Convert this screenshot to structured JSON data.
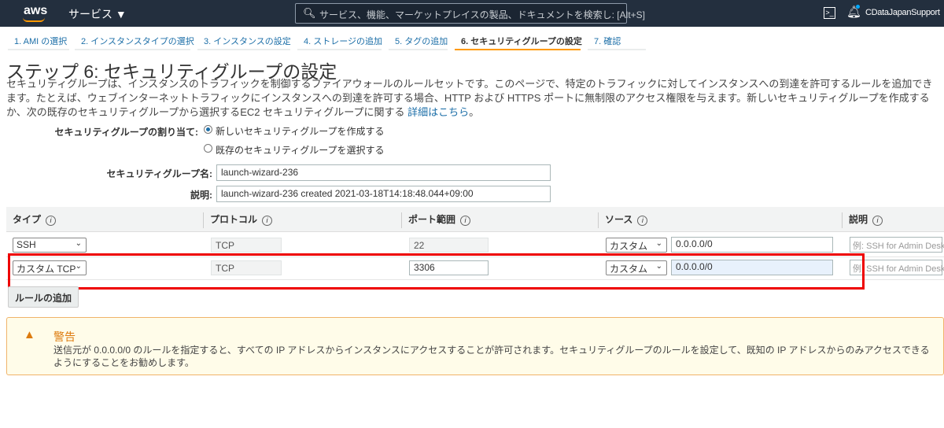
{
  "topbar": {
    "logo": "aws",
    "services": "サービス ▼",
    "search_placeholder": "サービス、機能、マーケットプレイスの製品、ドキュメントを検索し: [Alt+S]",
    "user": "CDataJapanSupport"
  },
  "steps": [
    "1. AMI の選択",
    "2. インスタンスタイプの選択",
    "3. インスタンスの設定",
    "4. ストレージの追加",
    "5. タグの追加",
    "6. セキュリティグループの設定",
    "7. 確認"
  ],
  "active_step": 6,
  "page": {
    "title": "ステップ 6: セキュリティグループの設定",
    "desc1": "セキュリティグループは、インスタンスのトラフィックを制御するファイアウォールのルールセットです。このページで、特定のトラフィックに対してインスタンスへの到達を許可するルールを追加できます。たとえば、ウェブ",
    "desc2": "インターネットトラフィックにインスタンスへの到達を許可する場合、HTTP および HTTPS ポートに無制限のアクセス権限を与えます。新しいセキュリティグループを作成するか、次の既存のセキュリティグループから選択する",
    "desc3": "EC2 セキュリティグループに関する ",
    "link": "詳細はこちら",
    "desc3_end": "。"
  },
  "form": {
    "assign_label": "セキュリティグループの割り当て:",
    "radio_new": "新しいセキュリティグループを作成する",
    "radio_existing": "既存のセキュリティグループを選択する",
    "selected": "new",
    "name_label": "セキュリティグループ名:",
    "name_value": "launch-wizard-236",
    "desc_label": "説明:",
    "desc_value": "launch-wizard-236 created 2021-03-18T14:18:48.044+09:00"
  },
  "table": {
    "headers": [
      "タイプ",
      "プロトコル",
      "ポート範囲",
      "ソース",
      "説明"
    ],
    "rows": [
      {
        "type": "SSH",
        "protocol": "TCP",
        "port": "22",
        "source_type": "カスタム",
        "source": "0.0.0.0/0",
        "desc_placeholder": "例: SSH for Admin Desktop"
      },
      {
        "type": "カスタム TCP",
        "protocol": "TCP",
        "port": "3306",
        "source_type": "カスタム",
        "source": "0.0.0.0/0",
        "desc_placeholder": "例: SSH for Admin Desktop"
      }
    ]
  },
  "add_rule": "ルールの追加",
  "warning": {
    "title": "警告",
    "text": "送信元が 0.0.0.0/0 のルールを指定すると、すべての IP アドレスからインスタンスにアクセスすることが許可されます。セキュリティグループのルールを設定して、既知の IP アドレスからのみアクセスできるようにすることをお勧めします。"
  },
  "colors": {
    "topbar": "#232f3e",
    "accent": "#ff9900",
    "link": "#1d6fa8",
    "highlight": "#ee0000",
    "warning": "#dd7b0e"
  }
}
